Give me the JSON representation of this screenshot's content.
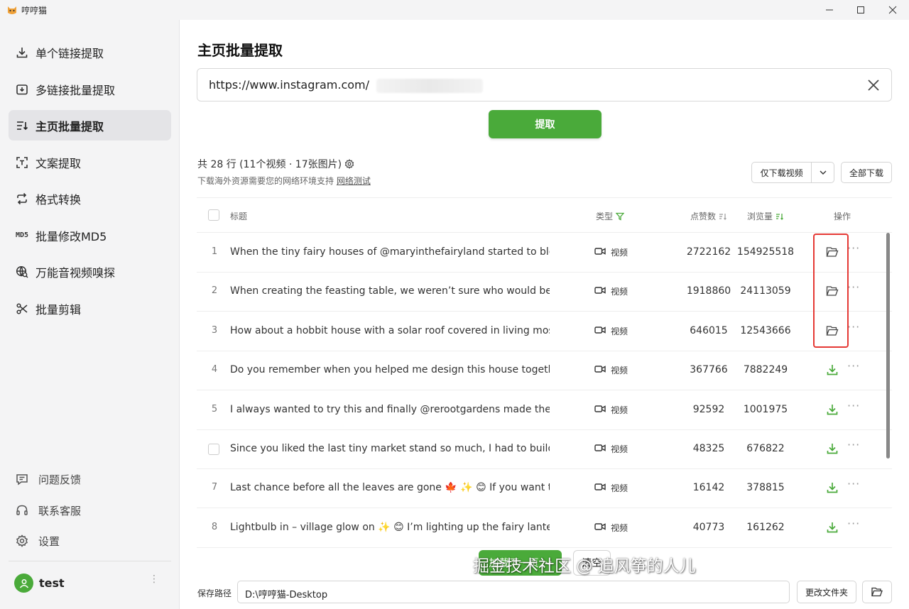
{
  "app": {
    "title": "哼哼猫"
  },
  "sidebar": {
    "items": [
      {
        "label": "单个链接提取",
        "icon": "download-icon"
      },
      {
        "label": "多链接批量提取",
        "icon": "batch-download-icon"
      },
      {
        "label": "主页批量提取",
        "icon": "list-sort-icon",
        "active": true
      },
      {
        "label": "文案提取",
        "icon": "text-scan-icon"
      },
      {
        "label": "格式转换",
        "icon": "repeat-icon"
      },
      {
        "label": "批量修改MD5",
        "icon": "md5-icon",
        "icon_text": "MD5"
      },
      {
        "label": "万能音视频嗅探",
        "icon": "globe-search-icon"
      },
      {
        "label": "批量剪辑",
        "icon": "scissors-icon"
      }
    ],
    "bottom": [
      {
        "label": "问题反馈",
        "icon": "message-icon"
      },
      {
        "label": "联系客服",
        "icon": "headset-icon"
      },
      {
        "label": "设置",
        "icon": "gear-icon"
      }
    ],
    "user": {
      "name": "test",
      "more": "⋮"
    }
  },
  "main": {
    "title": "主页批量提取",
    "url_value": "https://www.instagram.com/",
    "extract_label": "提取",
    "summary": "共 28 行 (11个视频 · 17张图片)",
    "note": "下载海外资源需要您的网络环境支持",
    "note_link": "网络测试",
    "download_video_label": "仅下载视频",
    "download_all_label": "全部下载",
    "columns": {
      "title": "标题",
      "type": "类型",
      "likes": "点赞数",
      "views": "浏览量",
      "action": "操作"
    },
    "rows": [
      {
        "index": "1",
        "title": "When the tiny fairy houses of @maryinthefairyland started to blo...",
        "type": "视频",
        "likes": "2722162",
        "views": "154925518",
        "action": "folder"
      },
      {
        "index": "2",
        "title": "When creating the feasting table, we weren’t sure who would be ...",
        "type": "视频",
        "likes": "1918860",
        "views": "24113059",
        "action": "folder"
      },
      {
        "index": "3",
        "title": "How about a hobbit house with a solar roof covered in living mos...",
        "type": "视频",
        "likes": "646015",
        "views": "12543666",
        "action": "folder"
      },
      {
        "index": "4",
        "title": "Do you remember when you helped me design this house togethe...",
        "type": "视频",
        "likes": "367766",
        "views": "7882249",
        "action": "download"
      },
      {
        "index": "5",
        "title": "I always wanted to try this and finally @rerootgardens made the d...",
        "type": "视频",
        "likes": "92592",
        "views": "1001975",
        "action": "download"
      },
      {
        "index": "",
        "checkbox": true,
        "title": "Since you liked the last tiny market stand so much, I had to build ...",
        "type": "视频",
        "likes": "48325",
        "views": "676822",
        "action": "download"
      },
      {
        "index": "7",
        "title": "Last chance before all the leaves are gone 🍁 ✨ 😊  If you want t...",
        "type": "视频",
        "likes": "16142",
        "views": "378815",
        "action": "download"
      },
      {
        "index": "8",
        "title": "Lightbulb in – village glow on ✨ 😊  I’m lighting up the fairy lante...",
        "type": "视频",
        "likes": "40773",
        "views": "161262",
        "action": "download"
      }
    ],
    "more_symbol": "···",
    "load_more_label": "加载下一页",
    "clear_label": "清空",
    "save_path_label": "保存路径",
    "save_path_value": "D:\\哼哼猫-Desktop",
    "change_folder_label": "更改文件夹"
  },
  "watermark": "掘金技术社区 @ 追风筝的人儿",
  "colors": {
    "accent": "#4aaa3a",
    "highlight": "#e53935",
    "active_bg": "#e4e4e7"
  }
}
